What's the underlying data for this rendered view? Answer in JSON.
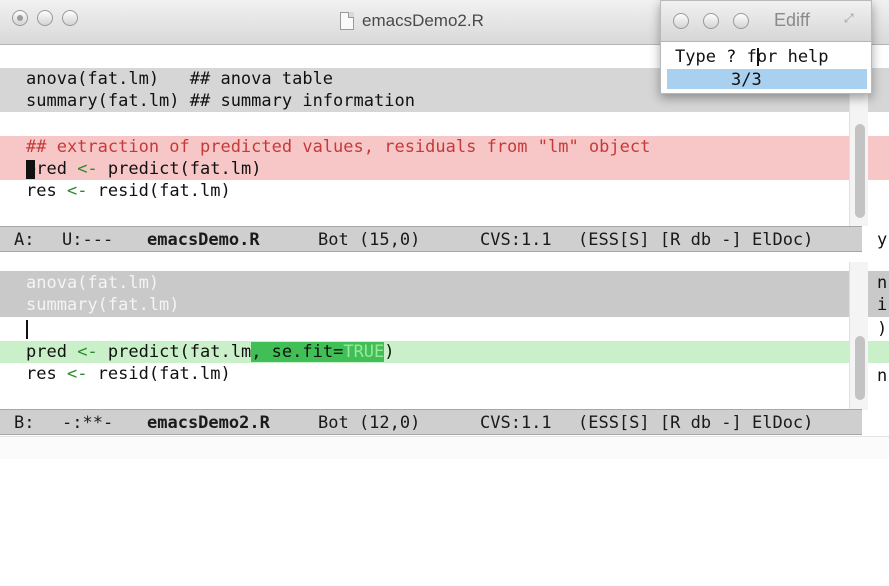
{
  "window": {
    "title": "emacsDemo2.R"
  },
  "pane_a": {
    "lines": [
      "anova(fat.lm)   ## anova table",
      "summary(fat.lm) ## summary information",
      "",
      "## extraction of predicted values, residuals from \"lm\" object",
      "pred <- predict(fat.lm)",
      "res <- resid(fat.lm)"
    ],
    "modeline": {
      "buffer_id": "A:",
      "status": "U:---",
      "filename": "emacsDemo.R",
      "position": "Bot (15,0)",
      "vcs": "CVS:1.1",
      "modes": "(ESS[S] [R db -] ElDoc)"
    }
  },
  "pane_b": {
    "lines": [
      "anova(fat.lm)",
      "summary(fat.lm)",
      "",
      "pred <- predict(fat.lm, se.fit=TRUE)",
      "res <- resid(fat.lm)"
    ],
    "modeline": {
      "buffer_id": "B:",
      "status": "-:**-",
      "filename": "emacsDemo2.R",
      "position": "Bot (12,0)",
      "vcs": "CVS:1.1",
      "modes": "(ESS[S] [R db -] ElDoc)"
    }
  },
  "side_pane_chars": [
    "y",
    "n",
    "i",
    ")",
    "n"
  ],
  "ediff": {
    "title": "Ediff",
    "help_text": "Type ? for help",
    "counter": "3/3"
  },
  "colors": {
    "region_gray": "#d6d6d6",
    "diff_a_bg": "#f7c7c7",
    "diff_b_bg": "#c9f0c9",
    "fine_diff_bg": "#3fbf55",
    "comment_red": "#c43a3a",
    "arrow_green": "#2a8a2a",
    "true_color": "#9be7a0",
    "selection_blue": "#a9d0ee"
  }
}
